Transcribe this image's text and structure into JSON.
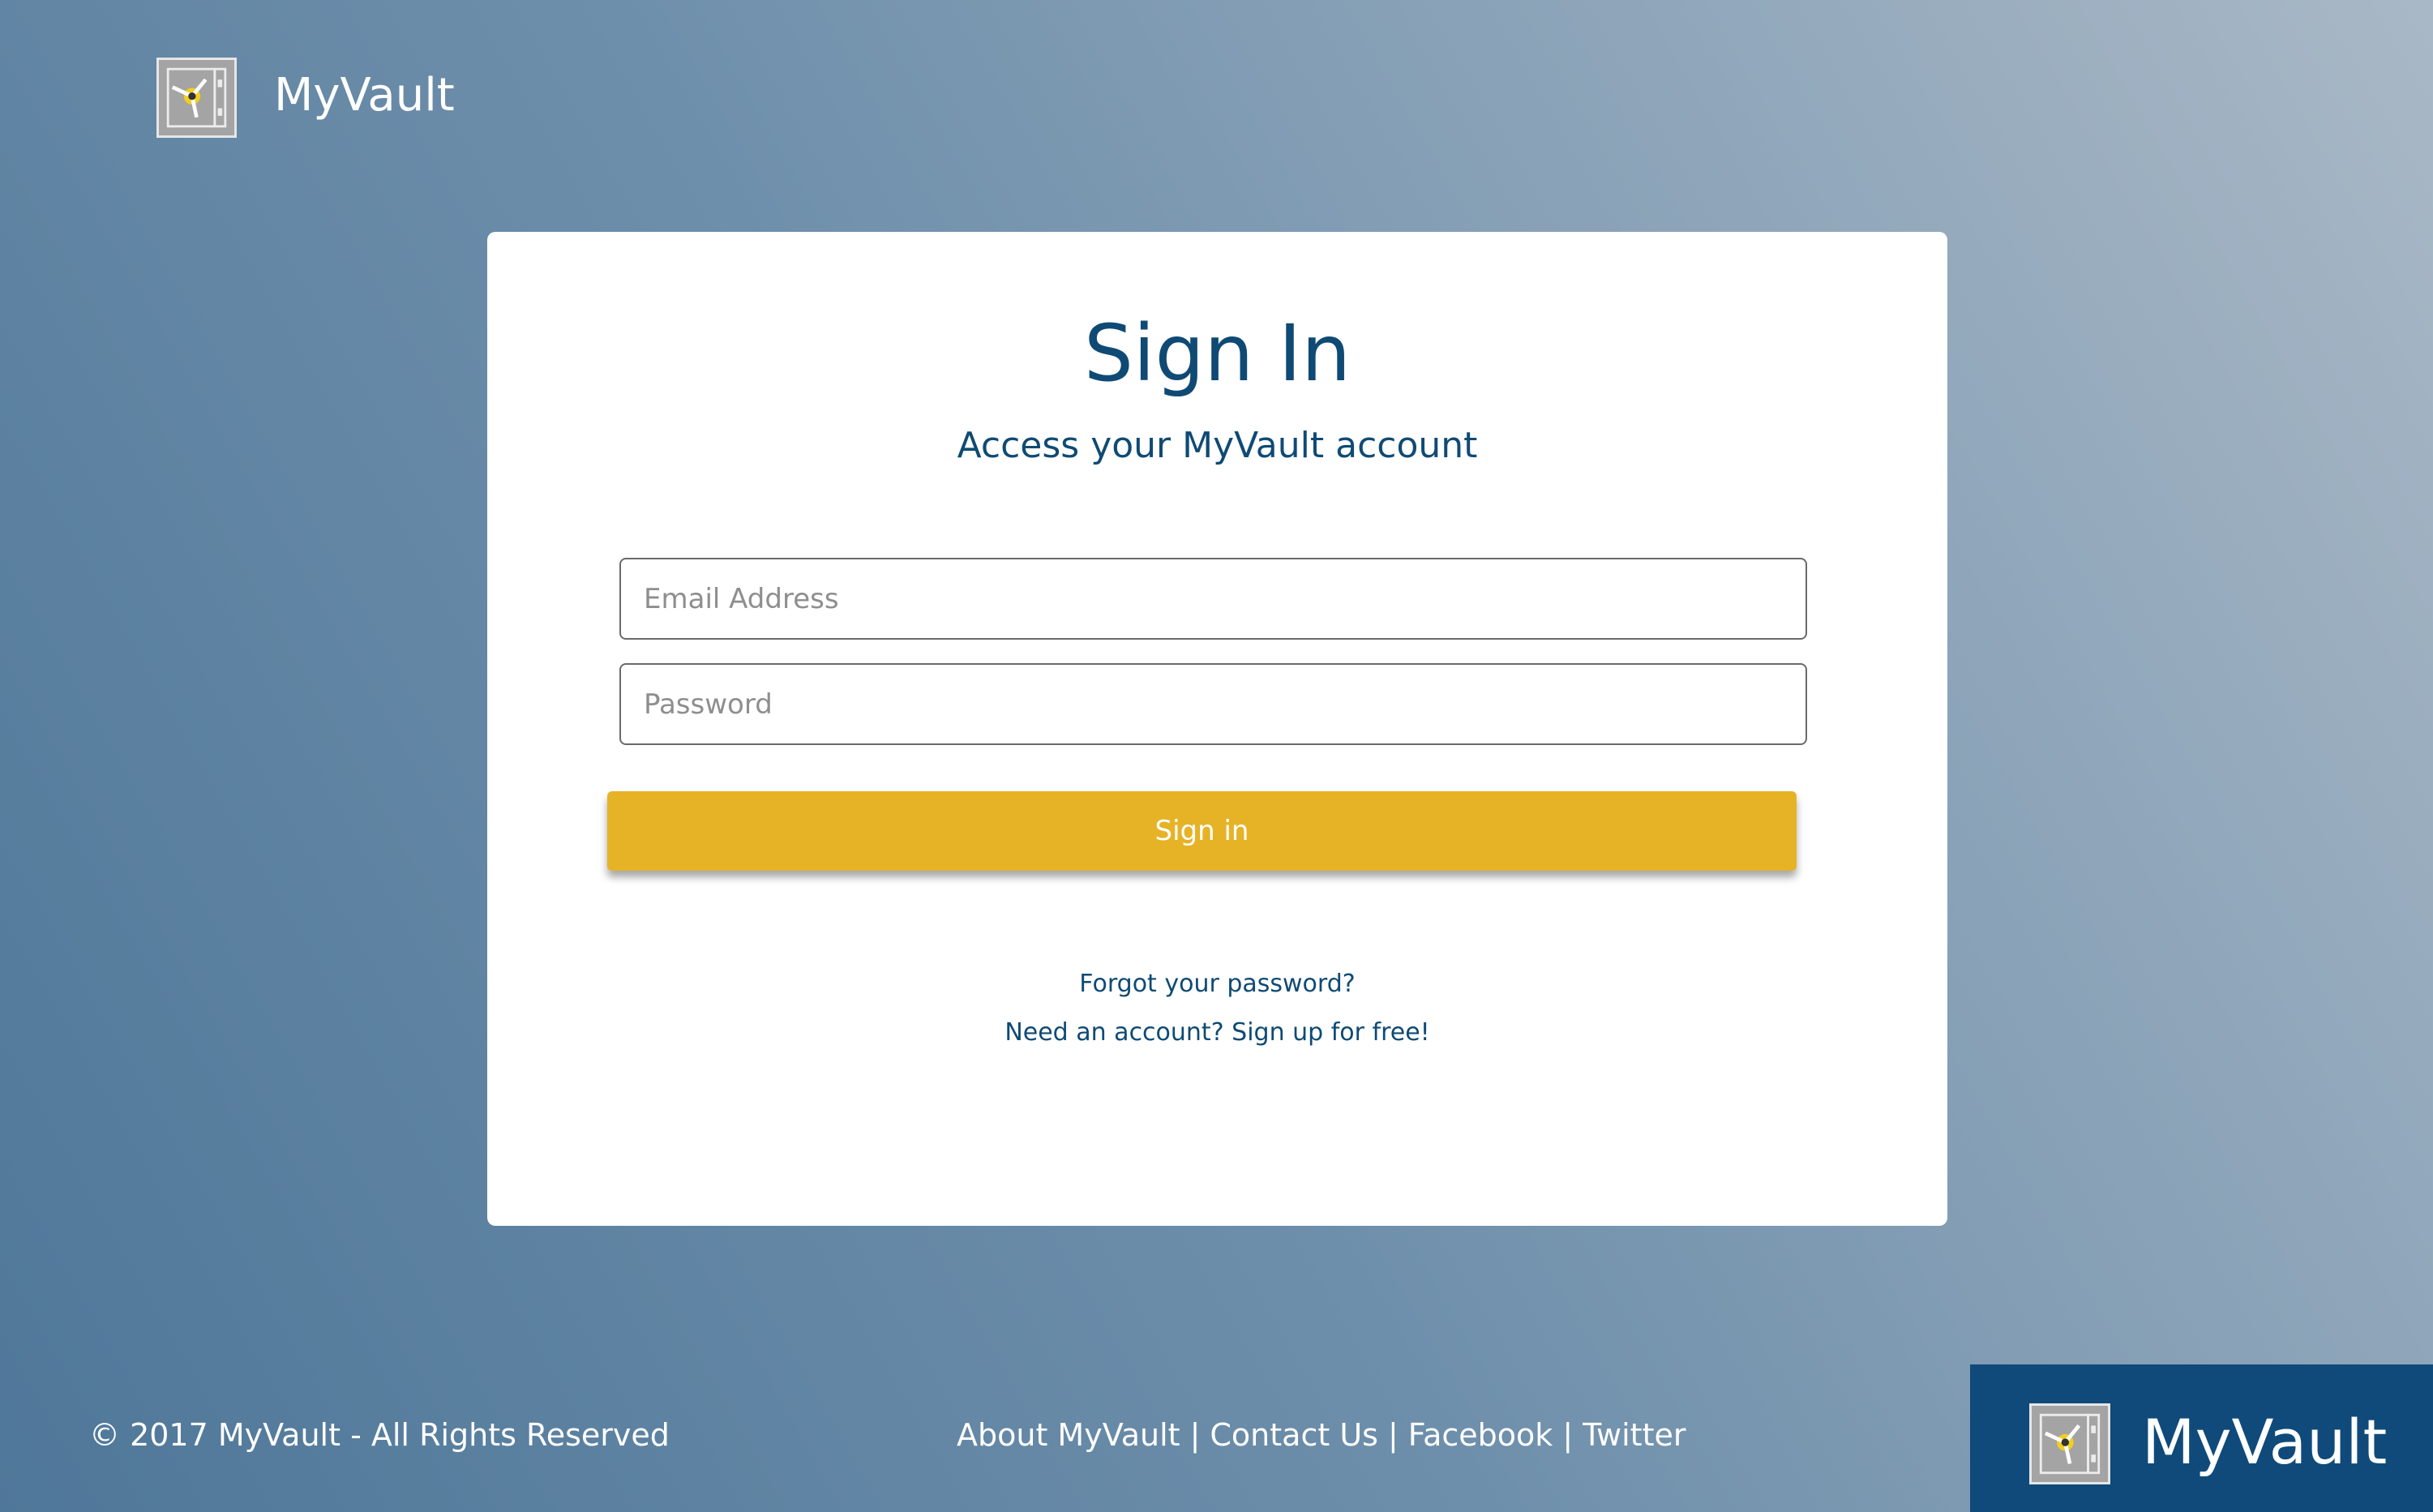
{
  "header": {
    "brand": "MyVault",
    "logo_icon": "vault-dial-icon"
  },
  "signin_card": {
    "title": "Sign In",
    "subtitle": "Access your MyVault account",
    "email_placeholder": "Email Address",
    "email_value": "",
    "password_placeholder": "Password",
    "password_value": "",
    "submit_label": "Sign in",
    "forgot_link": "Forgot your password?",
    "signup_link": "Need an account? Sign up for free!"
  },
  "footer": {
    "copyright": "© 2017 MyVault - All Rights Reserved",
    "links": [
      "About MyVault",
      "Contact Us",
      "Facebook",
      "Twitter"
    ],
    "separator": "|",
    "brand": "MyVault"
  },
  "colors": {
    "primary_text": "#0f4a74",
    "button": "#e6b326",
    "footer_brand_bg": "#0f4a7a",
    "logo_accent": "#f2cf1f"
  }
}
